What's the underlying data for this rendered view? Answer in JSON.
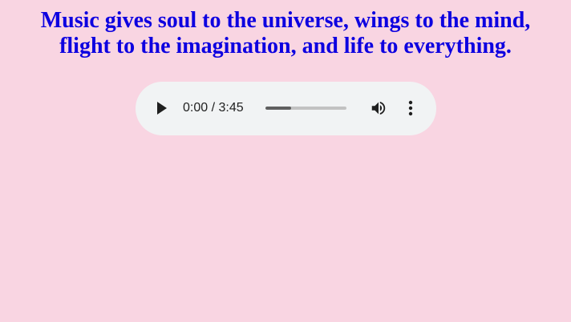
{
  "quote": {
    "line1": "Music gives soul to the universe, wings to the mind,",
    "line2": "flight to the imagination, and life to everything."
  },
  "player": {
    "time_display": "0:00 / 3:45",
    "current_time": "0:00",
    "duration": "3:45",
    "buffered_fraction": 0.32,
    "icons": {
      "play": "play-icon",
      "volume": "volume-icon",
      "menu": "more-vertical-icon"
    }
  },
  "colors": {
    "background": "#f9d5e2",
    "quote_text": "#0d00e0",
    "player_background": "#f1f3f4",
    "controls": "#1f1f1f"
  }
}
